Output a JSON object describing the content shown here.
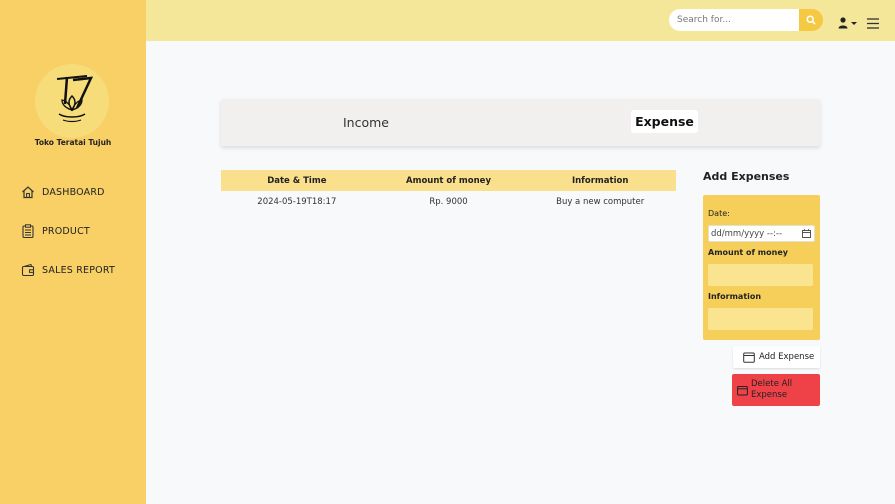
{
  "brand": {
    "name": "Toko Teratai Tujuh",
    "logo_text": "T7"
  },
  "sidebar": {
    "items": [
      {
        "label": "DASHBOARD",
        "icon": "home-icon"
      },
      {
        "label": "PRODUCT",
        "icon": "clipboard-icon"
      },
      {
        "label": "SALES REPORT",
        "icon": "wallet-icon"
      }
    ]
  },
  "topbar": {
    "search_placeholder": "Search for...",
    "search_icon": "search-icon",
    "user_icon": "user-icon",
    "menu_icon": "hamburger-menu-icon"
  },
  "tabs": {
    "income_label": "Income",
    "expense_label": "Expense",
    "active": "Expense"
  },
  "table": {
    "headers": [
      "Date & Time",
      "Amount of money",
      "Information"
    ],
    "rows": [
      [
        "2024-05-19T18:17",
        "Rp. 9000",
        "Buy a new computer"
      ]
    ]
  },
  "form": {
    "title": "Add Expenses",
    "date_label": "Date:",
    "date_placeholder": "dd/mm/yyyy --:--",
    "amount_label": "Amount of money",
    "amount_value": "",
    "info_label": "Information",
    "info_value": "",
    "add_button": "Add Expense",
    "delete_button": "Delete All Expense"
  },
  "colors": {
    "sidebar": "#f8d066",
    "topbar": "#f5e799",
    "accent": "#f6c945",
    "form_card": "#f6cf5b",
    "delete": "#ee4248"
  }
}
